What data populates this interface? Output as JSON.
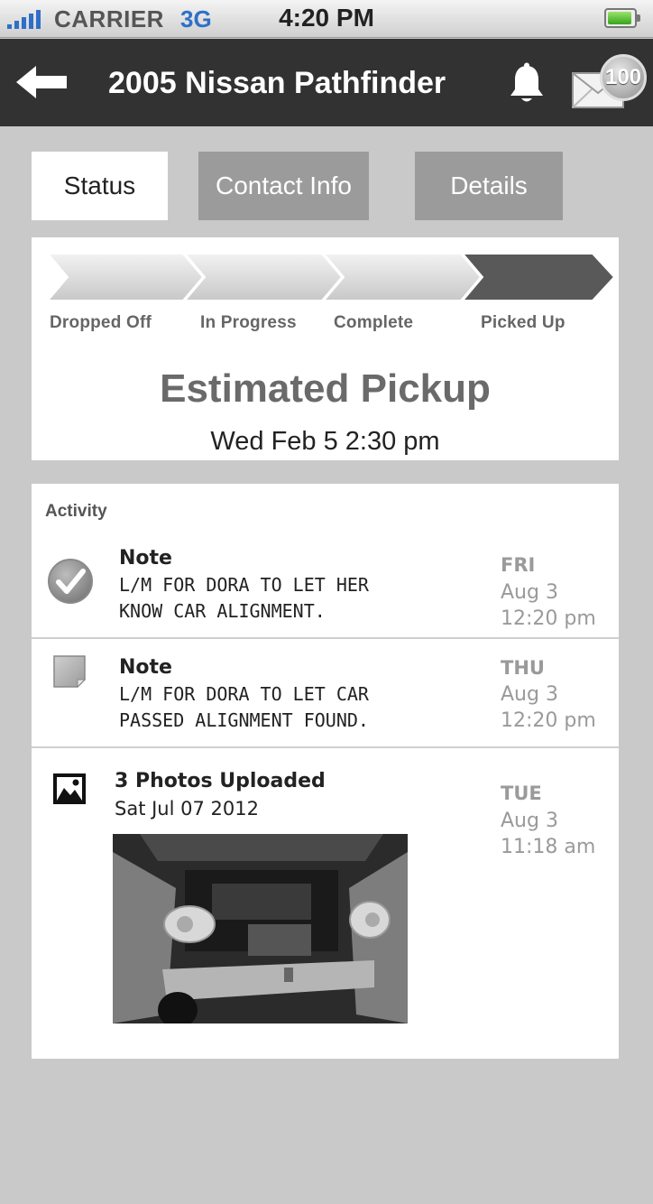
{
  "status_bar": {
    "carrier": "CARRIER",
    "network": "3G",
    "time": "4:20 PM"
  },
  "nav": {
    "back_icon": "back-arrow-icon",
    "title": "2005 Nissan Pathfinder",
    "bell_icon": "bell-icon",
    "mail_icon": "mail-icon",
    "mail_badge": "100"
  },
  "tabs": [
    {
      "label": "Status",
      "active": true
    },
    {
      "label": "Contact Info",
      "active": false
    },
    {
      "label": "Details",
      "active": false
    }
  ],
  "progress": {
    "steps": [
      "Dropped Off",
      "In Progress",
      "Complete",
      "Picked Up"
    ],
    "current_step": 4
  },
  "estimate": {
    "title": "Estimated Pickup",
    "time": "Wed Feb 5 2:30 pm"
  },
  "activity": {
    "heading": "Activity",
    "items": [
      {
        "icon": "checkmark-circle-icon",
        "title": "Note",
        "lines": [
          "L/M FOR DORA TO LET HER",
          "KNOW CAR ALIGNMENT."
        ],
        "day": "FRI",
        "date": "Aug 3",
        "time": "12:20 pm"
      },
      {
        "icon": "note-icon",
        "title": "Note",
        "lines": [
          "L/M FOR DORA TO LET  CAR",
          "PASSED ALIGNMENT FOUND."
        ],
        "day": "THU",
        "date": "Aug 3",
        "time": "12:20 pm"
      },
      {
        "icon": "photo-icon",
        "title": "3 Photos Uploaded",
        "subtitle": "Sat Jul 07 2012",
        "day": "TUE",
        "date": "Aug 3",
        "time": "11:18 am"
      }
    ]
  },
  "colors": {
    "background": "#c9c9c9",
    "navbar": "#323232",
    "tab_inactive": "#9b9b9b",
    "signal_blue": "#2f6fc8",
    "step_active": "#595959",
    "muted_text": "#9a9a9a"
  }
}
